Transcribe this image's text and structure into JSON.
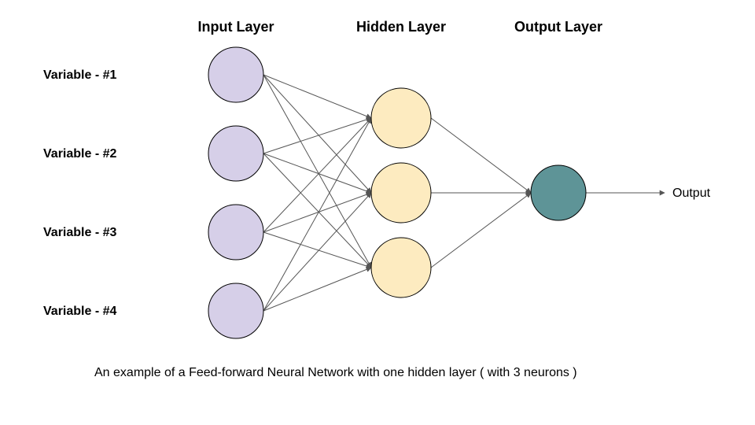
{
  "headers": {
    "input": "Input Layer",
    "hidden": "Hidden Layer",
    "output": "Output Layer"
  },
  "inputs": {
    "v1": "Variable - #1",
    "v2": "Variable - #2",
    "v3": "Variable - #3",
    "v4": "Variable - #4"
  },
  "output_label": "Output",
  "caption": "An example of a Feed-forward Neural Network with one hidden layer ( with 3 neurons )",
  "chart_data": {
    "type": "network-diagram",
    "layers": [
      {
        "name": "Input Layer",
        "neurons": 4,
        "labels": [
          "Variable - #1",
          "Variable - #2",
          "Variable - #3",
          "Variable - #4"
        ],
        "color": "#d6cfe8"
      },
      {
        "name": "Hidden Layer",
        "neurons": 3,
        "color": "#fdebc0"
      },
      {
        "name": "Output Layer",
        "neurons": 1,
        "labels": [
          "Output"
        ],
        "color": "#5e9497"
      }
    ],
    "connectivity": "fully-connected-forward",
    "title": "An example of a Feed-forward Neural Network with one hidden layer ( with 3 neurons )"
  }
}
